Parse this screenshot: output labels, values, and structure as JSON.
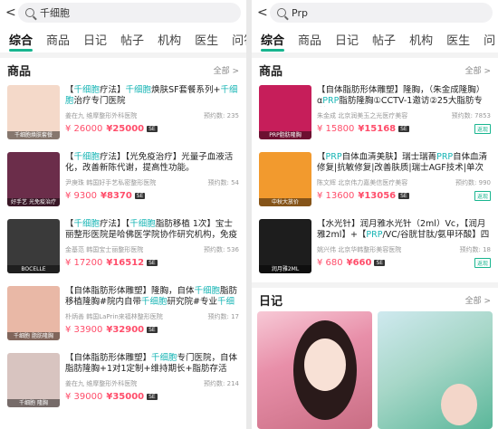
{
  "left": {
    "back": "<",
    "search": "千细胞",
    "tabs": [
      "综合",
      "商品",
      "日记",
      "帖子",
      "机构",
      "医生",
      "问答"
    ],
    "section_title": "商品",
    "section_more": "全部 >",
    "items": [
      {
        "title": "【千细胞疗法】千细胞焕肤SF套餐系列+千细胞治疗专门医院",
        "hosp": "姜在九 维摩整形外科医院",
        "count": "预约数: 235",
        "p1": "¥ 26000",
        "p2": "¥25000",
        "badge": "",
        "thumb_caption": "千细胞焕肤套餐",
        "thumb_color": "#f4d9c9"
      },
      {
        "title": "【千细胞疗法】【光免疫治疗】光量子血液活化，改善新陈代谢，提高性功能。",
        "hosp": "尹庚珠 韩国好手艺私密整形医院",
        "count": "预约数: 54",
        "p1": "¥ 9300",
        "p2": "¥8370",
        "badge": "",
        "thumb_caption": "好手艺 光免疫治疗",
        "thumb_color": "#6b2d4a"
      },
      {
        "title": "【千细胞疗法】【千细胞脂肪移植 1次】宝士丽整形医院是哈佛医学院协作研究机构，免疫",
        "hosp": "金基范 韩国宝士丽整形医院",
        "count": "预约数: 536",
        "p1": "¥ 17200",
        "p2": "¥16512",
        "badge": "",
        "thumb_caption": "BOCELLE",
        "thumb_color": "#3a3a3a"
      },
      {
        "title": "【自体脂肪形体雕塑】隆胸，自体千细胞脂肪移植隆胸#院内自带千细胞研究院#专业千细胞",
        "hosp": "朴炳善 韩国LaPrin来福林整形医院",
        "count": "预约数: 17",
        "p1": "¥ 33900",
        "p2": "¥32900",
        "badge": "",
        "thumb_caption": "千细胞 脂肪隆胸",
        "thumb_color": "#e9b8a6"
      },
      {
        "title": "【自体脂肪形体雕塑】千细胞专门医院，自体脂肪隆胸+1对1定制+维持期长+脂肪存活",
        "hosp": "姜在九 维摩整形外科医院",
        "count": "预约数: 214",
        "p1": "¥ 39000",
        "p2": "¥35000",
        "badge": "",
        "thumb_caption": "千细胞 隆胸",
        "thumb_color": "#d8c4c0"
      }
    ]
  },
  "right": {
    "back": "<",
    "search": "Prp",
    "tabs": [
      "综合",
      "商品",
      "日记",
      "帖子",
      "机构",
      "医生",
      "问"
    ],
    "section_title": "商品",
    "section_more": "全部 >",
    "items": [
      {
        "title": "【自体脂肪形体雕塑】隆胸，（朱金成隆胸）αPRP脂肪隆胸①CCTV-1邀访②25大脂肪专利",
        "hosp": "朱金成 北京润美玉之光医疗美容",
        "count": "预约数: 7853",
        "p1": "¥ 15800",
        "p2": "¥15168",
        "badge": "",
        "tag": "返现",
        "thumb_caption": "PRP脂肪隆胸",
        "thumb_color": "#c61e5a"
      },
      {
        "title": "【PRP自体血清美肤】瑞士瑞菁PRP自体血清修复|抗敏修复|改善肤质|瑞士AGF技术|单次",
        "hosp": "陈文辉 北京伟力嘉美信医疗美容",
        "count": "预约数: 990",
        "p1": "¥ 13600",
        "p2": "¥13056",
        "badge": "",
        "tag": "返现",
        "thumb_caption": "中秋大放价",
        "thumb_color": "#f29a2e"
      },
      {
        "title": "【水光针】润月雅水光针（2ml）Vc，【润月雅2ml】+【PRP/VC/谷胱甘肽/氨甲环酸】四",
        "hosp": "姚兴伟 北京华韩整形美容医院",
        "count": "预约数: 18",
        "p1": "¥ 680",
        "p2": "¥660",
        "badge": "",
        "tag": "返现",
        "thumb_caption": "润月雅2ML",
        "thumb_color": "#1d1d1d"
      }
    ],
    "diary_title": "日记",
    "diary_more": "全部 >"
  }
}
